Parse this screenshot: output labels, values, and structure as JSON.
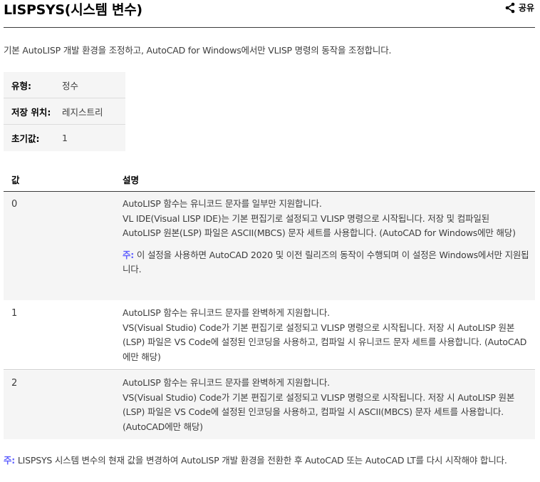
{
  "header": {
    "title": "LISPSYS(시스템 변수)",
    "share_label": "공유"
  },
  "intro": "기본 AutoLISP 개발 환경을 조정하고, AutoCAD for Windows에서만 VLISP 명령의 동작을 조정합니다.",
  "properties": [
    {
      "key": "유형:",
      "value": "정수"
    },
    {
      "key": "저장 위치:",
      "value": "레지스트리"
    },
    {
      "key": "초기값:",
      "value": "1"
    }
  ],
  "table": {
    "headers": [
      "값",
      "설명"
    ],
    "rows": [
      {
        "value": "0",
        "desc": "AutoLISP 함수는 유니코드 문자를 일부만 지원합니다.\nVL IDE(Visual LISP IDE)는 기본 편집기로 설정되고 VLISP 명령으로 시작됩니다. 저장 및 컴파일된 AutoLISP 원본(LSP) 파일은 ASCII(MBCS) 문자 세트를 사용합니다. (AutoCAD for Windows에만 해당)",
        "note_label": "주:",
        "note_text": " 이 설정을 사용하면 AutoCAD 2020 및 이전 릴리즈의 동작이 수행되며 이 설정은 Windows에서만 지원됩니다."
      },
      {
        "value": "1",
        "desc": "AutoLISP 함수는 유니코드 문자를 완벽하게 지원합니다.\nVS(Visual Studio) Code가 기본 편집기로 설정되고 VLISP 명령으로 시작됩니다. 저장 시 AutoLISP 원본(LSP) 파일은 VS Code에 설정된 인코딩을 사용하고, 컴파일 시 유니코드 문자 세트를 사용합니다. (AutoCAD에만 해당)"
      },
      {
        "value": "2",
        "desc": "AutoLISP 함수는 유니코드 문자를 완벽하게 지원합니다.\nVS(Visual Studio) Code가 기본 편집기로 설정되고 VLISP 명령으로 시작됩니다. 저장 시 AutoLISP 원본(LSP) 파일은 VS Code에 설정된 인코딩을 사용하고, 컴파일 시 ASCII(MBCS) 문자 세트를 사용합니다. (AutoCAD에만 해당)"
      }
    ]
  },
  "footnote": {
    "label": "주:",
    "text": " LISPSYS 시스템 변수의 현재 값을 변경하여 AutoLISP 개발 환경을 전환한 후 AutoCAD 또는 AutoCAD LT를 다시 시작해야 합니다."
  },
  "colors": {
    "note_accent": "#5f60ff",
    "shade": "#f5f5f5",
    "text": "#3c3c3c"
  }
}
